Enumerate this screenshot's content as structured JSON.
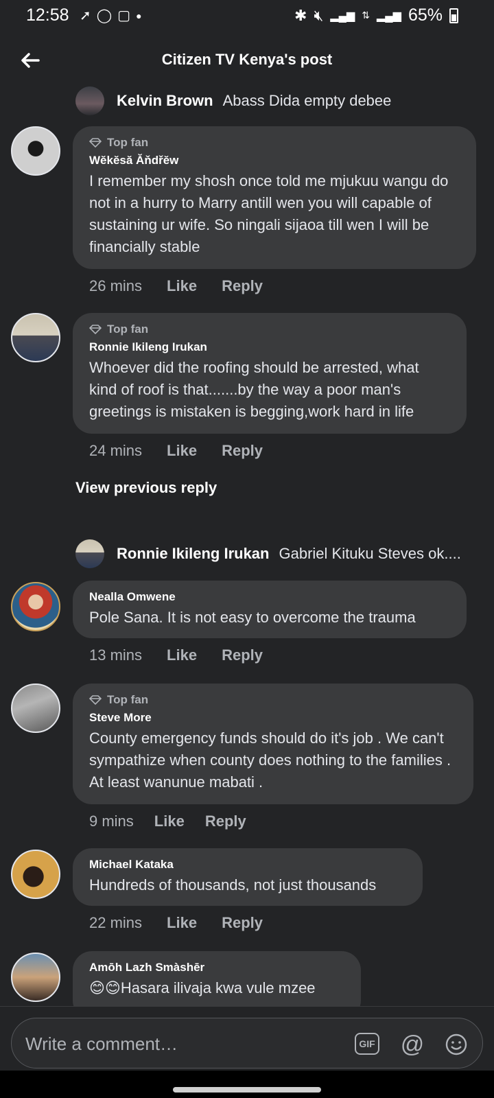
{
  "status_bar": {
    "time": "12:58",
    "battery": "65%",
    "left_icons": [
      "thread-icon",
      "whatsapp-icon",
      "instagram-icon",
      "dot-icon"
    ],
    "right_icons": [
      "bluetooth-icon",
      "mute-icon",
      "signal-icon",
      "data-icon",
      "signal-icon"
    ]
  },
  "header": {
    "title": "Citizen TV Kenya's post"
  },
  "inline_replies": [
    {
      "name": "Kelvin Brown",
      "text": "Abass Dida empty debee"
    },
    {
      "name": "Ronnie Ikileng Irukan",
      "text": "Gabriel Kituku Steves ok...."
    }
  ],
  "comments": [
    {
      "badge": "Top fan",
      "author": "Wĕkĕsă Ăňdřĕw",
      "text": "I remember my shosh once told me mjukuu wangu do not in a hurry to Marry antill wen you will capable of sustaining ur wife. So ningali sijaoa till wen I will be financially stable",
      "time": "26 mins",
      "like": "Like",
      "reply": "Reply"
    },
    {
      "badge": "Top fan",
      "author": "Ronnie Ikileng Irukan",
      "text": "Whoever did the roofing should be arrested, what kind of roof is that.......by the way a poor man's greetings is mistaken is begging,work hard in life",
      "time": "24 mins",
      "like": "Like",
      "reply": "Reply"
    },
    {
      "badge": "",
      "author": "Nealla Omwene",
      "text": "Pole Sana.  It is not easy to overcome the trauma",
      "time": "13 mins",
      "like": "Like",
      "reply": "Reply"
    },
    {
      "badge": "Top fan",
      "author": "Steve More",
      "text": "County emergency funds should do it's job . We can't sympathize when county does nothing to the families . At least wanunue mabati .",
      "time": "9 mins",
      "like": "Like",
      "reply": "Reply"
    },
    {
      "badge": "",
      "author": "Michael Kataka",
      "text": "Hundreds of thousands, not just thousands",
      "time": "22 mins",
      "like": "Like",
      "reply": "Reply"
    },
    {
      "badge": "",
      "author": "Amōh Lazh Smàshēr",
      "text": "😊😊Hasara ilivaja kwa vule mzee",
      "time": "",
      "like": "",
      "reply": ""
    }
  ],
  "view_previous": "View previous reply",
  "composer": {
    "placeholder": "Write a comment…",
    "gif_label": "GIF"
  },
  "colors": {
    "background": "#232426",
    "bubble": "#3a3b3d",
    "secondary_text": "#b0b3b8"
  }
}
